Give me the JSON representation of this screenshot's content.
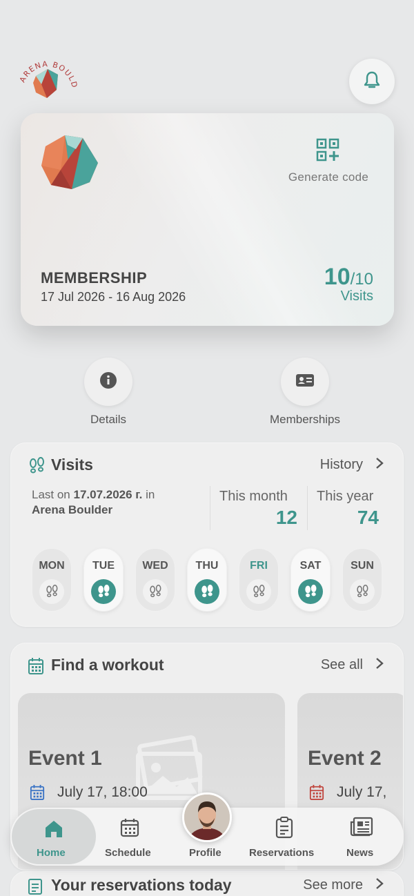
{
  "brand": {
    "logo_text": "ARENA BOULDER"
  },
  "header": {
    "bell_icon": "bell-icon"
  },
  "membership": {
    "generate_code_label": "Generate code",
    "title": "MEMBERSHIP",
    "dates": "17 Jul 2026 - 16 Aug 2026",
    "visits_used": "10",
    "visits_total": "/10",
    "visits_label": "Visits"
  },
  "actions": [
    {
      "label": "Details",
      "icon": "info-icon"
    },
    {
      "label": "Memberships",
      "icon": "id-card-icon"
    }
  ],
  "visits": {
    "title": "Visits",
    "history_label": "History",
    "last_on_prefix": "Last on ",
    "last_on_date": "17.07.2026 г.",
    "last_on_mid": " in",
    "last_on_place": "Arena Boulder",
    "this_month_label": "This month",
    "this_month_value": "12",
    "this_year_label": "This year",
    "this_year_value": "74",
    "days": [
      {
        "name": "MON",
        "visited": false
      },
      {
        "name": "TUE",
        "visited": true
      },
      {
        "name": "WED",
        "visited": false
      },
      {
        "name": "THU",
        "visited": true
      },
      {
        "name": "FRI",
        "visited": false,
        "today": true
      },
      {
        "name": "SAT",
        "visited": true
      },
      {
        "name": "SUN",
        "visited": false
      }
    ]
  },
  "workout": {
    "title": "Find a workout",
    "see_all_label": "See all",
    "events": [
      {
        "title": "Event 1",
        "date": "July 17, 18:00"
      },
      {
        "title": "Event 2",
        "date": "July 17,"
      }
    ]
  },
  "nav": {
    "items": [
      {
        "label": "Home",
        "icon": "home-icon",
        "active": true
      },
      {
        "label": "Schedule",
        "icon": "calendar-icon"
      },
      {
        "label": "Profile",
        "icon": "avatar"
      },
      {
        "label": "Reservations",
        "icon": "clipboard-icon"
      },
      {
        "label": "News",
        "icon": "newspaper-icon"
      }
    ]
  },
  "reservations": {
    "title": "Your reservations today",
    "see_more_label": "See more"
  },
  "colors": {
    "teal": "#3e958c",
    "red": "#c0463e",
    "orange": "#e07a4f"
  }
}
